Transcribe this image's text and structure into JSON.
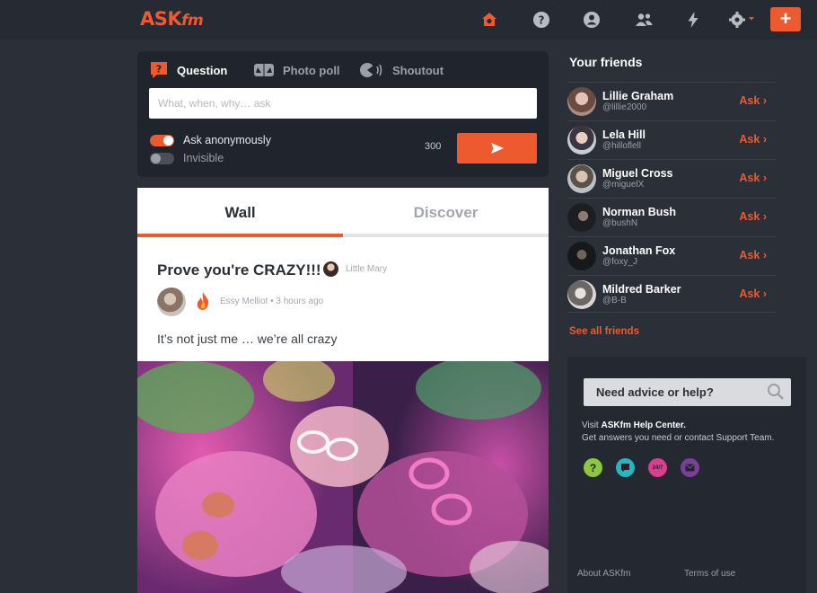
{
  "header": {
    "logo_main": "ASK",
    "logo_suffix": "fm",
    "icons": [
      "home-icon",
      "help-icon",
      "profile-icon",
      "friends-icon",
      "lightning-icon",
      "settings-icon"
    ],
    "plus_label": "+"
  },
  "composer": {
    "tabs": [
      {
        "label": "Question",
        "icon": "question-icon"
      },
      {
        "label": "Photo poll",
        "icon": "photo-poll-icon"
      },
      {
        "label": "Shoutout",
        "icon": "shoutout-icon"
      }
    ],
    "placeholder": "What, when, why… ask",
    "anonymous_label": "Ask anonymously",
    "invisible_label": "Invisible",
    "char_count": "300"
  },
  "feed": {
    "tabs": [
      "Wall",
      "Discover"
    ],
    "post": {
      "title": "Prove you're CRAZY!!!",
      "tagged_user": "Little Mary",
      "author_line": "Essy Melliot • 3 hours ago",
      "text": "It’s not just me … we’re all crazy"
    }
  },
  "friends": {
    "title": "Your friends",
    "ask_label": "Ask",
    "items": [
      {
        "name": "Lillie Graham",
        "handle": "@lillie2000"
      },
      {
        "name": "Lela Hill",
        "handle": "@hilloflell"
      },
      {
        "name": "Miguel Cross",
        "handle": "@miguelX"
      },
      {
        "name": "Norman Bush",
        "handle": "@bushN"
      },
      {
        "name": "Jonathan Fox",
        "handle": "@foxy_J"
      },
      {
        "name": "Mildred Barker",
        "handle": "@B-B"
      }
    ],
    "see_all": "See all friends"
  },
  "help": {
    "search_label": "Need advice or help?",
    "line1_prefix": "Visit ",
    "line1_link": "ASKfm Help Center.",
    "line2": "Get answers you need or contact Support Team.",
    "channel_247": "24/7",
    "channel_icons": [
      "faq-icon",
      "chat-icon",
      "support-247-icon",
      "email-icon"
    ]
  },
  "footer": {
    "about": "About ASKfm",
    "terms": "Terms of use"
  },
  "colors": {
    "accent": "#ee5a2f",
    "background": "#2a2f38",
    "panel": "#20252d"
  }
}
